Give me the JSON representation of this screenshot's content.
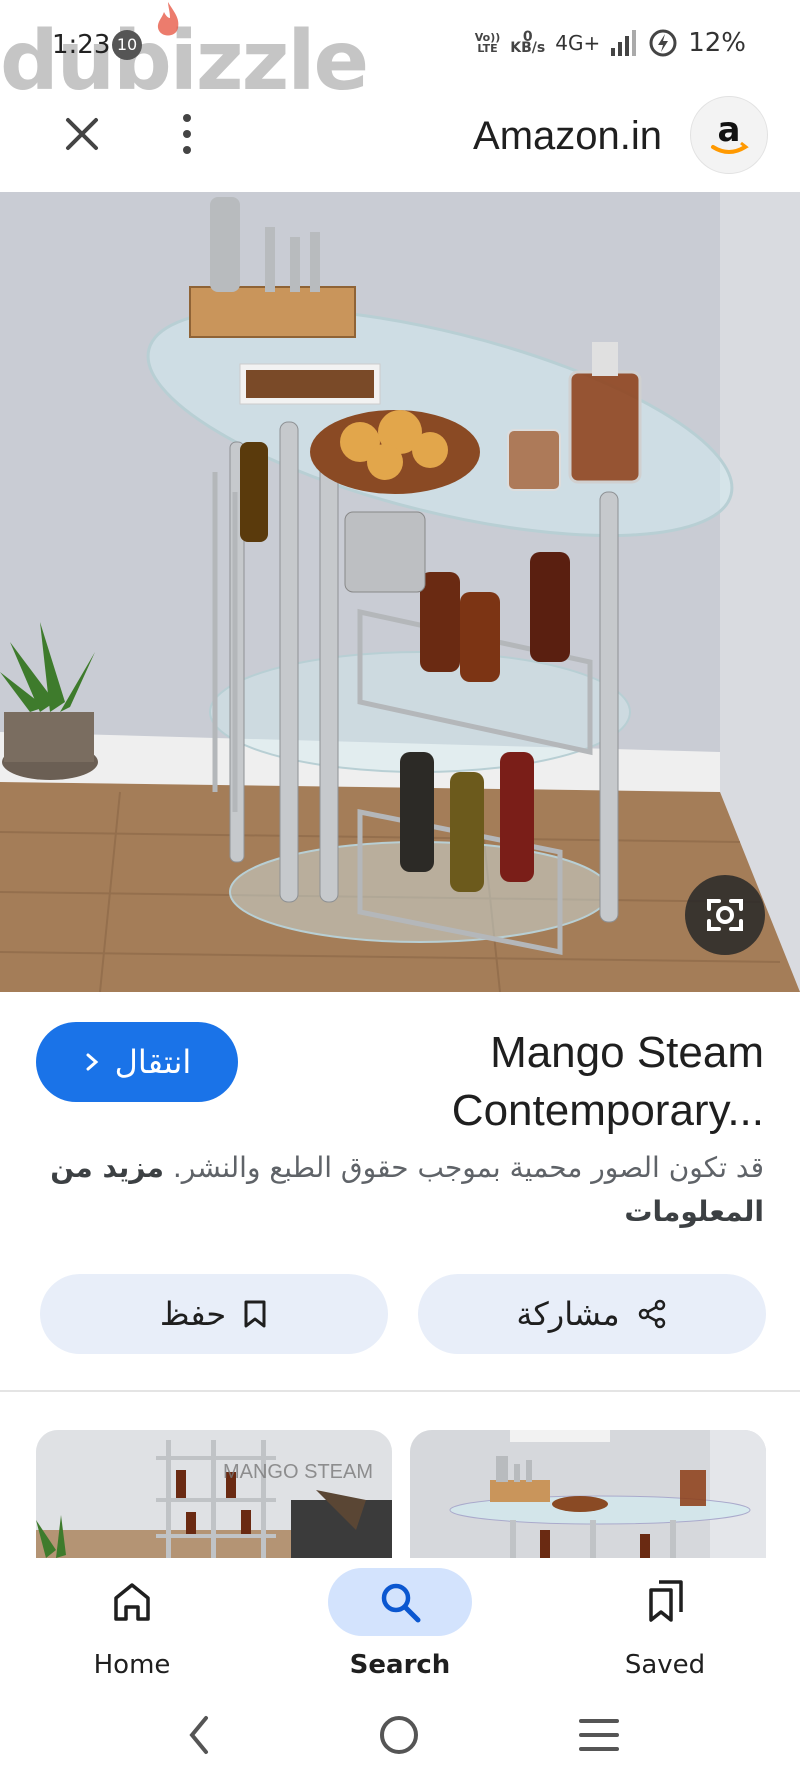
{
  "status_bar": {
    "time": "1:23",
    "notification_count": "10",
    "network_top": "Vo))",
    "network_bottom": "LTE",
    "speed_value": "0",
    "speed_unit": "KB/s",
    "network_type": "4G+",
    "battery": "12%"
  },
  "watermark": "dubizzle",
  "header": {
    "source": "Amazon.in",
    "source_logo_letter": "a"
  },
  "result": {
    "title_line1": "Mango Steam",
    "title_line2": "Contemporary...",
    "visit_label": "انتقال",
    "copyright_text": "قد تكون الصور محمية بموجب حقوق الطبع والنشر.",
    "learn_more": "مزيد من المعلومات",
    "save_label": "حفظ",
    "share_label": "مشاركة"
  },
  "thumbnails": [
    {
      "watermark": "MANGO STEAM"
    },
    {
      "watermark": ""
    }
  ],
  "bottom_nav": {
    "items": [
      {
        "label": "Home",
        "icon": "home-icon"
      },
      {
        "label": "Search",
        "icon": "search-icon",
        "active": true
      },
      {
        "label": "Saved",
        "icon": "saved-icon"
      }
    ]
  },
  "colors": {
    "accent": "#1a73e8",
    "pill_bg": "#e8eef9",
    "active_nav": "#d3e3fd"
  }
}
